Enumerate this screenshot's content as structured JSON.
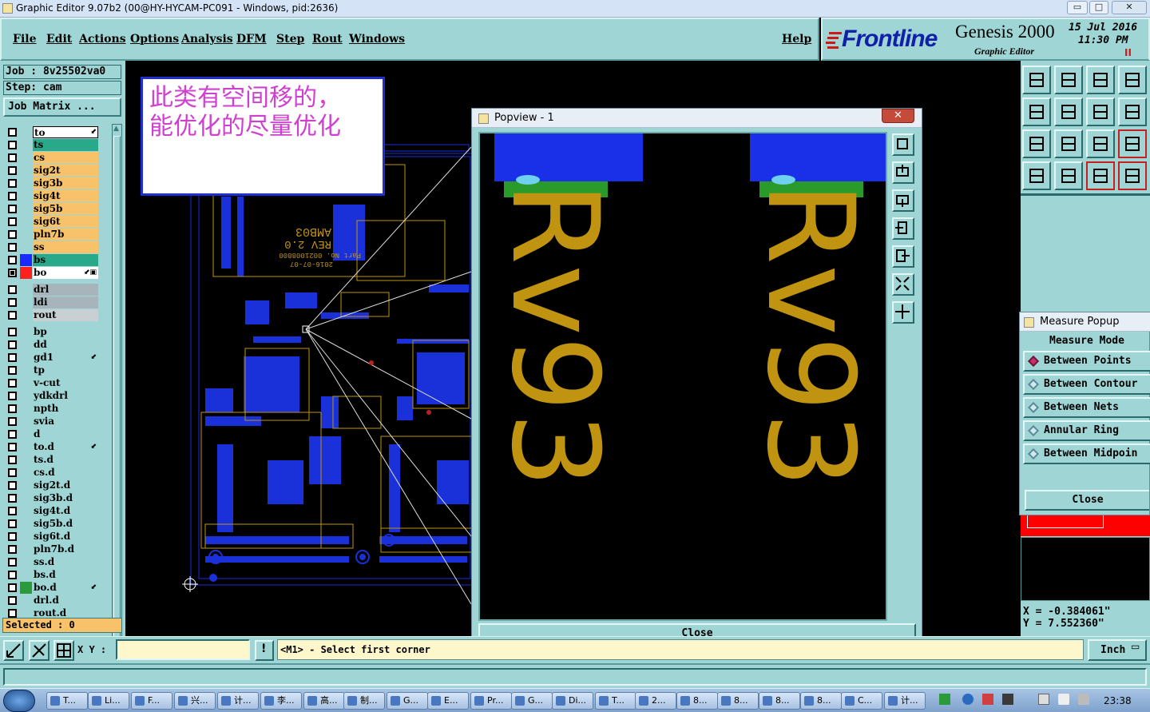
{
  "window": {
    "title": "Graphic Editor 9.07b2 (00@HY-HYCAM-PC091 - Windows, pid:2636)",
    "min": "▭",
    "max": "□",
    "close": "✕"
  },
  "menu": {
    "items": [
      "File",
      "Edit",
      "Actions",
      "Options",
      "Analysis",
      "DFM",
      "Step",
      "Rout",
      "Windows"
    ],
    "help": "Help"
  },
  "brand": {
    "logo": "Frontline",
    "product": "Genesis 2000",
    "subtitle": "Graphic Editor",
    "date": "15 Jul 2016",
    "time": "11:30 PM",
    "pause": "II"
  },
  "job": {
    "job_label": "Job : 8v25502va0",
    "step_label": "Step: cam",
    "matrix_button": "Job Matrix ...",
    "selected": "Selected : 0"
  },
  "layers": [
    {
      "name": "to",
      "color": "#ffffff",
      "checked": false,
      "active": true,
      "mark": "⬋"
    },
    {
      "name": "ts",
      "color": "#2aa88a",
      "checked": false
    },
    {
      "name": "cs",
      "color": "#f7c26a",
      "checked": false
    },
    {
      "name": "sig2t",
      "color": "#f7c26a",
      "checked": false
    },
    {
      "name": "sig3b",
      "color": "#f7c26a",
      "checked": false
    },
    {
      "name": "sig4t",
      "color": "#f7c26a",
      "checked": false
    },
    {
      "name": "sig5b",
      "color": "#f7c26a",
      "checked": false
    },
    {
      "name": "sig6t",
      "color": "#f7c26a",
      "checked": false
    },
    {
      "name": "pln7b",
      "color": "#f7c26a",
      "checked": false
    },
    {
      "name": "ss",
      "color": "#f7c26a",
      "checked": false
    },
    {
      "name": "bs",
      "color": "#2aa88a",
      "checked": false,
      "swatch": "#1a2aff"
    },
    {
      "name": "bo",
      "color": "#ffffff",
      "checked": true,
      "swatch": "#ff2020",
      "mark": "⬋▣"
    },
    {
      "name": "drl",
      "color": "#a8b4bc",
      "checked": false,
      "gap": true
    },
    {
      "name": "ldi",
      "color": "#a8b4bc",
      "checked": false
    },
    {
      "name": "rout",
      "color": "#c8d0d4",
      "checked": false
    },
    {
      "name": "bp",
      "color": "#9fd5d5",
      "checked": false,
      "gap": true
    },
    {
      "name": "dd",
      "color": "#9fd5d5",
      "checked": false
    },
    {
      "name": "gd1",
      "color": "#9fd5d5",
      "checked": false,
      "mark": "⬋"
    },
    {
      "name": "tp",
      "color": "#9fd5d5",
      "checked": false
    },
    {
      "name": "v-cut",
      "color": "#9fd5d5",
      "checked": false
    },
    {
      "name": "ydkdrl",
      "color": "#9fd5d5",
      "checked": false
    },
    {
      "name": "npth",
      "color": "#9fd5d5",
      "checked": false
    },
    {
      "name": "svia",
      "color": "#9fd5d5",
      "checked": false
    },
    {
      "name": "d",
      "color": "#9fd5d5",
      "checked": false
    },
    {
      "name": "to.d",
      "color": "#9fd5d5",
      "checked": false,
      "mark": "⬋"
    },
    {
      "name": "ts.d",
      "color": "#9fd5d5",
      "checked": false
    },
    {
      "name": "cs.d",
      "color": "#9fd5d5",
      "checked": false
    },
    {
      "name": "sig2t.d",
      "color": "#9fd5d5",
      "checked": false
    },
    {
      "name": "sig3b.d",
      "color": "#9fd5d5",
      "checked": false
    },
    {
      "name": "sig4t.d",
      "color": "#9fd5d5",
      "checked": false
    },
    {
      "name": "sig5b.d",
      "color": "#9fd5d5",
      "checked": false
    },
    {
      "name": "sig6t.d",
      "color": "#9fd5d5",
      "checked": false
    },
    {
      "name": "pln7b.d",
      "color": "#9fd5d5",
      "checked": false
    },
    {
      "name": "ss.d",
      "color": "#9fd5d5",
      "checked": false
    },
    {
      "name": "bs.d",
      "color": "#9fd5d5",
      "checked": false
    },
    {
      "name": "bo.d",
      "color": "#9fd5d5",
      "checked": false,
      "swatch": "#2a9a3a",
      "mark": "⬋"
    },
    {
      "name": "drl.d",
      "color": "#9fd5d5",
      "checked": false
    },
    {
      "name": "rout.d",
      "color": "#9fd5d5",
      "checked": false
    }
  ],
  "note": {
    "line1": "此类有空间移的，",
    "line2": "能优化的尽量优化"
  },
  "board": {
    "part_id": "AMB03",
    "rev": "REV 2.0",
    "part_no": "Part No. 0021008800",
    "date": "2016-07-07"
  },
  "popview": {
    "title": "Popview - 1",
    "close_button": "Close",
    "text_left": "Rv93",
    "text_right": "Rv93"
  },
  "measure": {
    "title": "Measure Popup",
    "header": "Measure Mode",
    "options": [
      "Between Points",
      "Between Contour",
      "Between Nets",
      "Annular Ring",
      "Between Midpoin"
    ],
    "selected_index": 0,
    "close_button": "Close"
  },
  "coords": {
    "x": "X = -0.384061\"",
    "y": "Y = 7.552360\""
  },
  "bottom": {
    "xy_label": "X Y :",
    "xy_value": "",
    "message": "<M1> - Select first corner",
    "alert": "!",
    "unit_button": "Inch"
  },
  "taskbar": {
    "items": [
      "T...",
      "Li...",
      "F...",
      "兴...",
      "计...",
      "李...",
      "高...",
      "制...",
      "G...",
      "E...",
      "Pr...",
      "G...",
      "Di...",
      "T...",
      "2...",
      "8...",
      "8...",
      "8...",
      "8...",
      "C...",
      "计..."
    ],
    "clock": "23:38"
  }
}
